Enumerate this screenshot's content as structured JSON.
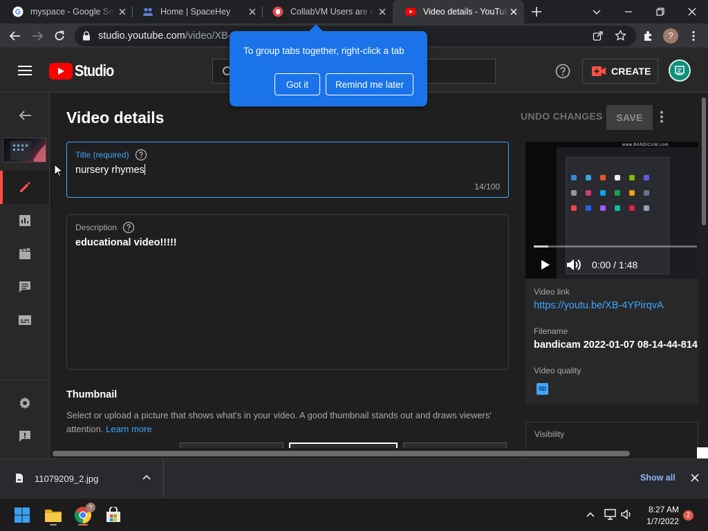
{
  "browser": {
    "tabs": [
      {
        "title": "myspace - Google Search",
        "favicon": "google-icon"
      },
      {
        "title": "Home | SpaceHey",
        "favicon": "spacehey-icon"
      },
      {
        "title": "CollabVM Users are creating",
        "favicon": "collabvm-icon"
      },
      {
        "title": "Video details - YouTube Studio",
        "favicon": "youtube-icon",
        "active": true
      }
    ],
    "url_host": "studio.youtube.com",
    "url_path": "/video/XB-"
  },
  "tab_tip": {
    "text": "To group tabs together, right-click a tab",
    "got_it": "Got it",
    "remind": "Remind me later"
  },
  "studio_header": {
    "brand": "Studio",
    "create_label": "CREATE"
  },
  "page": {
    "title": "Video details",
    "undo_label": "UNDO CHANGES",
    "save_label": "SAVE"
  },
  "title_field": {
    "label": "Title (required)",
    "value": "nursery rhymes",
    "counter": "14/100"
  },
  "description_field": {
    "label": "Description",
    "value": "educational video!!!!!"
  },
  "thumbnail": {
    "heading": "Thumbnail",
    "description": "Select or upload a picture that shows what's in your video. A good thumbnail stands out and draws viewers' attention.",
    "learn_more": "Learn more"
  },
  "video_card": {
    "time": "0:00 / 1:48",
    "progress": 0.09,
    "watermark": "www.BANDICAM.com",
    "link_label": "Video link",
    "link": "https://youtu.be/XB-4YPirqvA",
    "filename_label": "Filename",
    "filename": "bandicam 2022-01-07 08-14-44-814",
    "quality_label": "Video quality",
    "quality_badge": "SD"
  },
  "visibility": {
    "label": "Visibility"
  },
  "downloads": {
    "filename": "11079209_2.jpg",
    "show_all": "Show all"
  },
  "taskbar": {
    "time": "8:27 AM",
    "date": "1/7/2022",
    "notifications": "2",
    "chrome_badge": "?"
  },
  "profile": {
    "initial": "?"
  },
  "colors": {
    "youtube_red": "#ff0000",
    "accent_blue": "#3ea6ff",
    "tip_blue": "#1a73e8",
    "sidebar_active": "#ff4e45"
  }
}
